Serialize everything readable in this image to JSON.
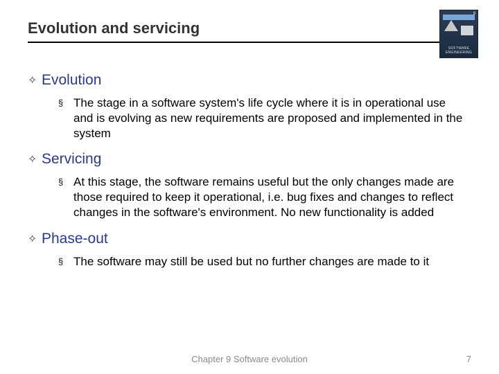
{
  "title": "Evolution and servicing",
  "book_label": "SOFTWARE ENGINEERING",
  "book_edition": "9",
  "sections": [
    {
      "heading": "Evolution",
      "body": "The stage in a software system's life cycle where it is in operational use and is evolving as new requirements are proposed and implemented in the system"
    },
    {
      "heading": "Servicing",
      "body": "At this stage, the software remains useful but the only changes made are those required to keep it operational, i.e. bug fixes and changes to reflect changes in the software's environment. No new functionality is added"
    },
    {
      "heading": "Phase-out",
      "body": "The software may still be used but no further changes are made to it"
    }
  ],
  "footer": {
    "chapter": "Chapter 9 Software evolution",
    "page": "7"
  },
  "bullets": {
    "lvl1": "✧",
    "lvl2": "§"
  }
}
